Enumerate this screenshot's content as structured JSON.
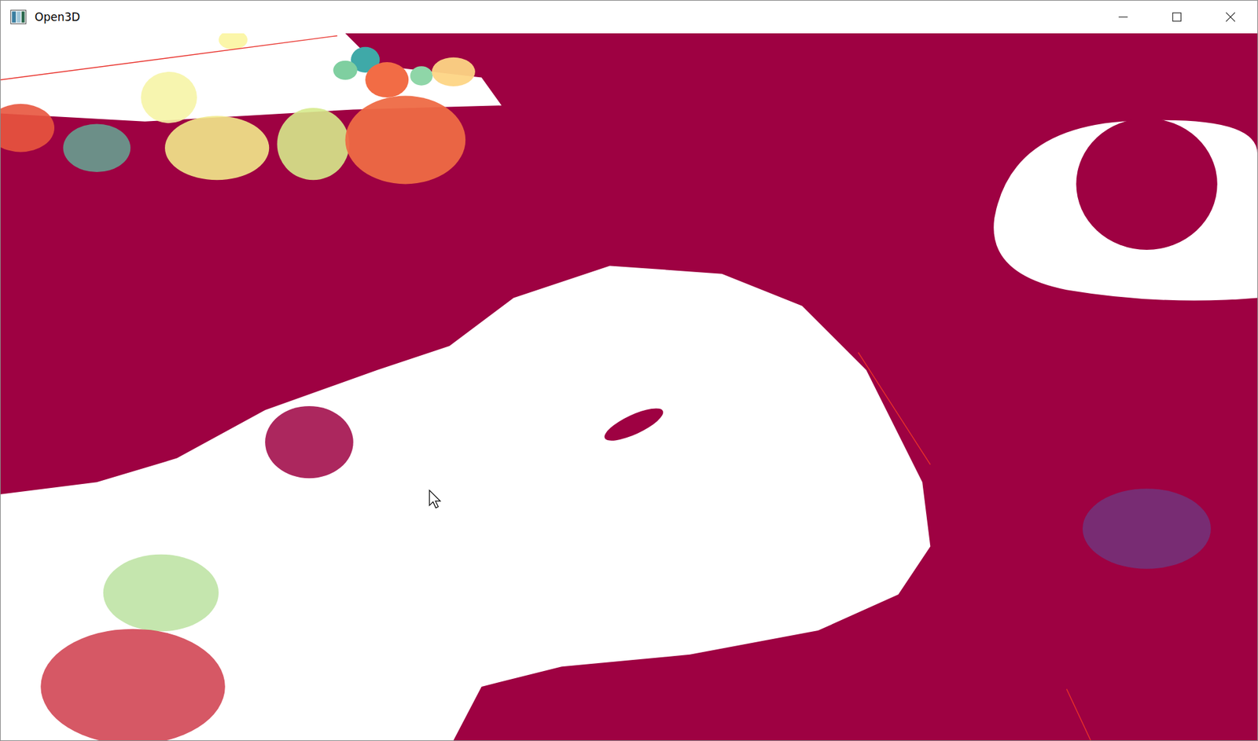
{
  "window": {
    "title": "Open3D"
  },
  "clusters": [
    {
      "color": "#f6f4a6"
    },
    {
      "color": "#fbf5a0"
    },
    {
      "color": "#3fa9a8"
    },
    {
      "color": "#7fcfa0"
    },
    {
      "color": "#f26c45"
    },
    {
      "color": "#8fd6a8"
    },
    {
      "color": "#fdd585"
    },
    {
      "color": "#e8553e"
    },
    {
      "color": "#5bbfa0"
    },
    {
      "color": "#f2ea8c"
    },
    {
      "color": "#d6ea8c"
    },
    {
      "color": "#ee6a45"
    },
    {
      "color": "#b6e09a"
    },
    {
      "color": "#cf3b4a"
    },
    {
      "color": "#4a62b0"
    }
  ]
}
